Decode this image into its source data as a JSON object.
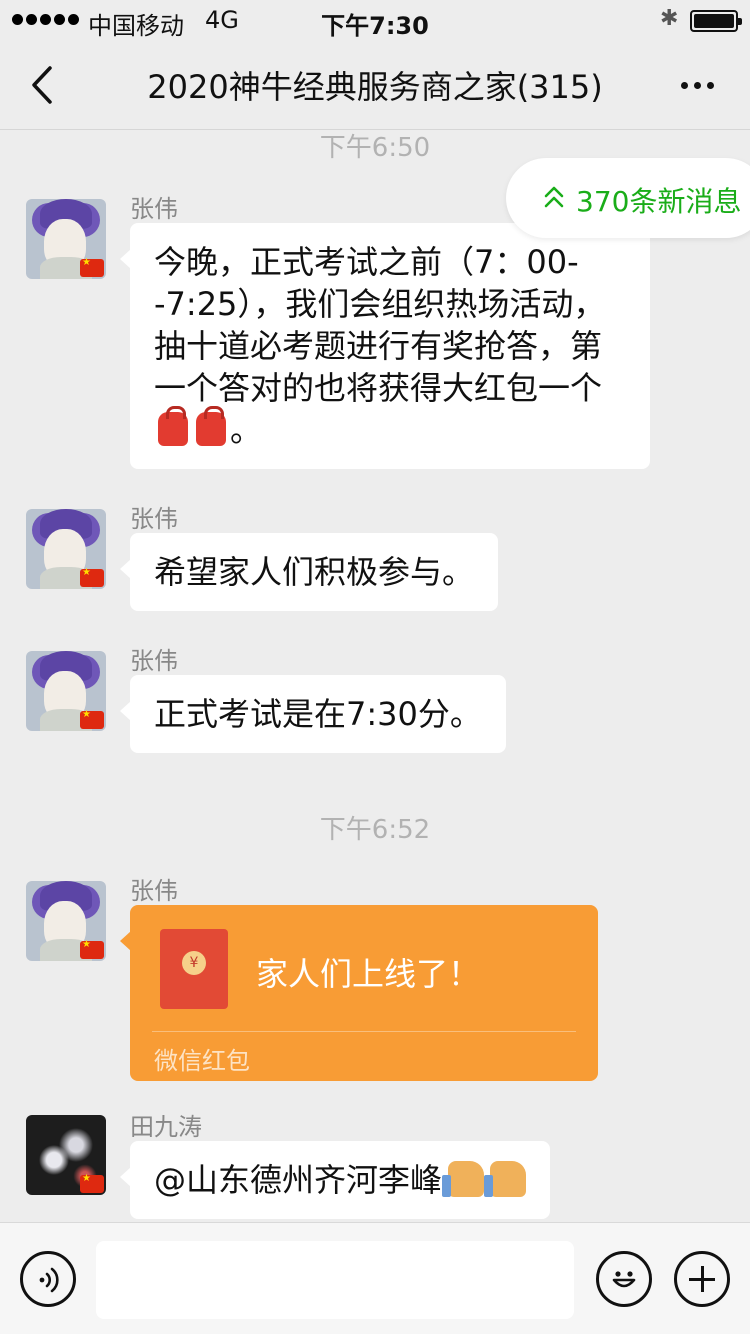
{
  "status_bar": {
    "carrier": "中国移动",
    "network": "4G",
    "time": "下午7:30",
    "icons": [
      "signal-icon",
      "bluetooth-icon",
      "battery-icon"
    ]
  },
  "header": {
    "title": "2020神牛经典服务商之家(315)",
    "icons": [
      "back-icon",
      "more-icon"
    ]
  },
  "new_messages": {
    "label": "370条新消息",
    "icon": "double-chevron-up-icon",
    "color": "#1aad19"
  },
  "messages": [
    {
      "type": "time",
      "text": "下午6:50"
    },
    {
      "type": "text",
      "sender": "张伟",
      "text": "今晚，正式考试之前（7：00--7:25），我们会组织热场活动，抽十道必考题进行有奖抢答，第一个答对的也将获得大红包一个",
      "trailing_text": "。",
      "emoji": [
        "red-bag-emoji",
        "red-bag-emoji"
      ]
    },
    {
      "type": "text",
      "sender": "张伟",
      "text": "希望家人们积极参与。"
    },
    {
      "type": "text",
      "sender": "张伟",
      "text": "正式考试是在7:30分。"
    },
    {
      "type": "time",
      "text": "下午6:52"
    },
    {
      "type": "red_packet",
      "sender": "张伟",
      "text": "家人们上线了！",
      "label": "微信红包",
      "color": "#f89c35"
    },
    {
      "type": "text",
      "sender": "田九涛",
      "text": "@山东德州齐河李峰",
      "emoji": [
        "thumbs-up-emoji",
        "thumbs-up-emoji"
      ]
    }
  ],
  "input_bar": {
    "icons": [
      "voice-icon",
      "emoji-icon",
      "plus-icon"
    ],
    "value": ""
  }
}
